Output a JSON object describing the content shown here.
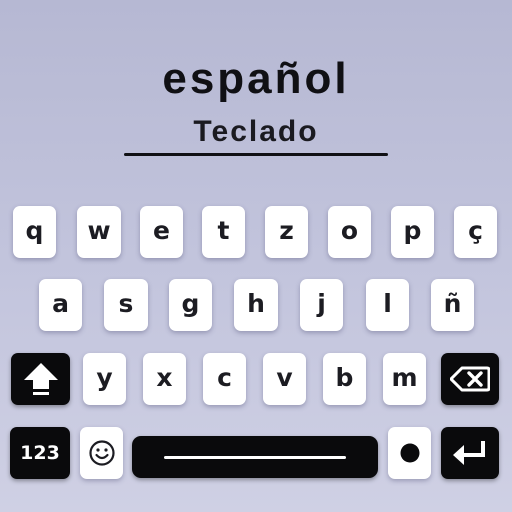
{
  "header": {
    "title": "español",
    "subtitle": "Teclado"
  },
  "keyboard": {
    "row1": [
      "q",
      "w",
      "e",
      "t",
      "z",
      "o",
      "p",
      "ç"
    ],
    "row2": [
      "a",
      "s",
      "g",
      "h",
      "j",
      "l",
      "ñ"
    ],
    "row3": [
      "y",
      "x",
      "c",
      "v",
      "b",
      "m"
    ],
    "numbers_label": "123",
    "icons": {
      "shift": "shift-arrow-icon",
      "backspace": "backspace-icon",
      "emoji": "smiley-face-icon",
      "dot": "dot-icon",
      "enter": "enter-return-icon"
    }
  },
  "colors": {
    "background_top": "#b6b8d3",
    "background_bottom": "#cfd0e4",
    "key_light": "#ffffff",
    "key_dark": "#0a0a0c",
    "text_dark": "#101014"
  }
}
